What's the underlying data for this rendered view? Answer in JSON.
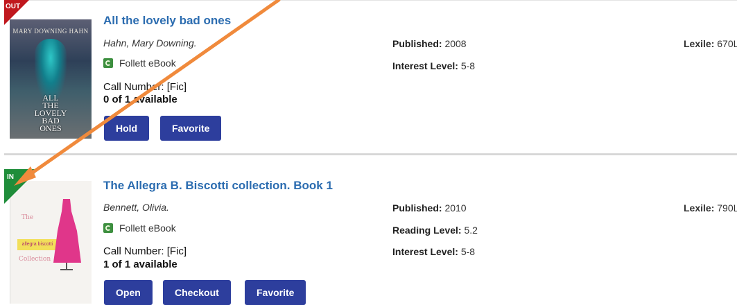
{
  "results": [
    {
      "status": "OUT",
      "title": "All the lovely bad ones",
      "author": "Hahn, Mary Downing.",
      "format": "Follett eBook",
      "call_number": "Call Number: [Fic]",
      "availability": "0 of 1 available",
      "cover": {
        "author_text": "MARY DOWNING HAHN",
        "title_text": "ALL\nTHE\nLOVELY\nBAD\nONES"
      },
      "buttons": [
        "Hold",
        "Favorite"
      ],
      "published_label": "Published:",
      "published": "2008",
      "interest_label": "Interest Level:",
      "interest": "5-8",
      "lexile_label": "Lexile:",
      "lexile": "670L"
    },
    {
      "status": "IN",
      "title": "The Allegra B. Biscotti collection. Book 1",
      "author": "Bennett, Olivia.",
      "format": "Follett eBook",
      "call_number": "Call Number: [Fic]",
      "availability": "1 of 1 available",
      "cover": {
        "label_text": "allegra biscotti",
        "top_word": "The",
        "bottom_word": "Collection"
      },
      "buttons": [
        "Open",
        "Checkout",
        "Favorite"
      ],
      "published_label": "Published:",
      "published": "2010",
      "reading_label": "Reading Level:",
      "reading": "5.2",
      "interest_label": "Interest Level:",
      "interest": "5-8",
      "lexile_label": "Lexile:",
      "lexile": "790L"
    }
  ],
  "colors": {
    "accent_button": "#2d3e9d",
    "title_link": "#2b6cb0",
    "status_out": "#c0181e",
    "status_in": "#1f8d3a",
    "annotation_arrow": "#f08a3c"
  },
  "icons": {
    "format": "ebook-icon",
    "annotation": "arrow-icon"
  }
}
